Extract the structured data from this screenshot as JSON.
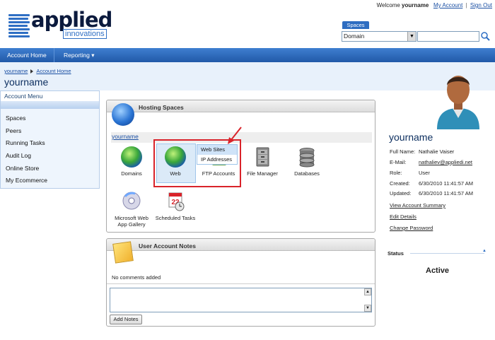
{
  "header": {
    "welcome_prefix": "Welcome",
    "username": "yourname",
    "my_account": "My Account",
    "separator": "|",
    "sign_out": "Sign Out",
    "logo_text": "applied",
    "logo_sub": "innovations",
    "spaces_label": "Spaces",
    "space_selected": "Domain",
    "search_value": ""
  },
  "nav": {
    "items": [
      {
        "label": "Account Home"
      },
      {
        "label": "Reporting ▾"
      }
    ]
  },
  "breadcrumb": {
    "items": [
      "yourname",
      "Account Home"
    ]
  },
  "page_title": "yourname",
  "sidebar": {
    "title": "Account Menu",
    "items": [
      {
        "label": "Spaces"
      },
      {
        "label": "Peers"
      },
      {
        "label": "Running Tasks"
      },
      {
        "label": "Audit Log"
      },
      {
        "label": "Online Store"
      },
      {
        "label": "My Ecommerce"
      }
    ]
  },
  "hosting": {
    "title": "Hosting Spaces",
    "space_name": "yourname",
    "tiles": [
      {
        "label": "Domains",
        "icon": "domains-globe-icon"
      },
      {
        "label": "Web",
        "icon": "web-globe-icon"
      },
      {
        "label": "FTP Accounts",
        "icon": "ftp-icon"
      },
      {
        "label": "File Manager",
        "icon": "file-cabinet-icon"
      },
      {
        "label": "Databases",
        "icon": "database-icon"
      },
      {
        "label": "Microsoft Web App Gallery",
        "icon": "web-app-gallery-icon"
      },
      {
        "label": "Scheduled Tasks",
        "icon": "calendar-clock-icon"
      }
    ],
    "web_menu": [
      "Web Sites",
      "IP Addresses"
    ],
    "calendar_day": "22"
  },
  "notes": {
    "title": "User Account Notes",
    "empty_text": "No comments added",
    "textarea_value": "",
    "add_button": "Add Notes"
  },
  "profile": {
    "name": "yourname",
    "fields": [
      {
        "label": "Full Name:",
        "value": "Nathalie Vaiser"
      },
      {
        "label": "E-Mail:",
        "value": "nathaliev@appliedi.net"
      },
      {
        "label": "Role:",
        "value": "User"
      },
      {
        "label": "Created:",
        "value": "6/30/2010 11:41:57 AM"
      },
      {
        "label": "Updated:",
        "value": "6/30/2010 11:41:57 AM"
      }
    ],
    "links": [
      "View Account Summary",
      "Edit Details",
      "Change Password"
    ],
    "status_title": "Status",
    "status_value": "Active"
  },
  "colors": {
    "nav_blue": "#2e6dc1",
    "link_blue": "#1a4fa3",
    "highlight_red": "#d9232a",
    "title_navy": "#0e3060"
  }
}
